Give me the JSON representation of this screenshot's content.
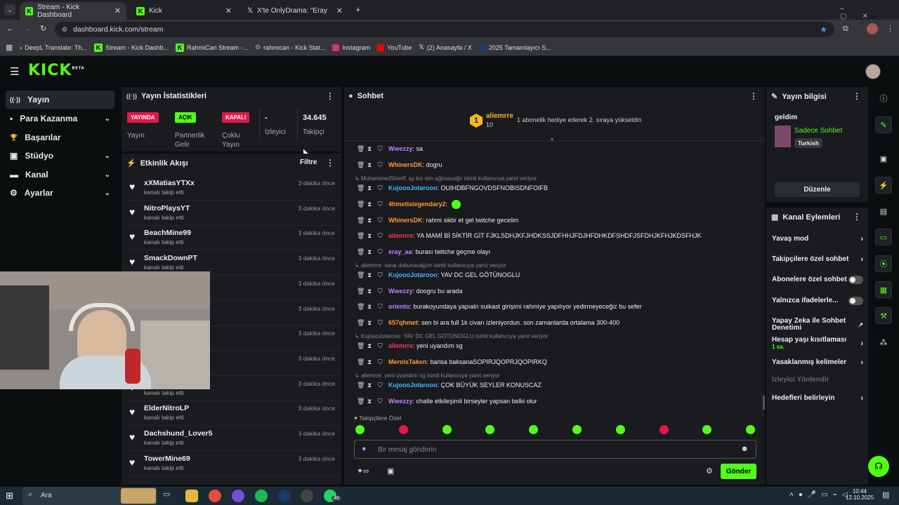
{
  "browser": {
    "tabs": [
      {
        "title": "Stream - Kick Dashboard",
        "close": "✕"
      },
      {
        "title": "Kick",
        "close": "✕"
      },
      {
        "title": "X'te OnlyDrama: \"Eray ve Dizci",
        "close": "✕"
      }
    ],
    "new_tab": "+",
    "url": "dashboard.kick.com/stream",
    "bookmarks": [
      "DeepL Translate: Th...",
      "Stream - Kick Dashb...",
      "RahmiCan Stream -...",
      "rahmican - Kick Stat...",
      "Instagram",
      "YouTube",
      "(2) Anasayfa / X",
      "2025 Tamamlayıcı S..."
    ]
  },
  "app": {
    "logo": "KICK",
    "logo_sup": "BETA"
  },
  "nav": {
    "items": [
      {
        "label": "Yayın",
        "icon": "((·))"
      },
      {
        "label": "Para Kazanma",
        "icon": "▪"
      },
      {
        "label": "Başarılar",
        "icon": "🏆"
      },
      {
        "label": "Stüdyo",
        "icon": "▣"
      },
      {
        "label": "Kanal",
        "icon": "▬"
      },
      {
        "label": "Ayarlar",
        "icon": "⚙"
      }
    ],
    "chev": "⌄"
  },
  "stats": {
    "title": "Yayın İstatistikleri",
    "badges": [
      "YAYINDA",
      "AÇIK",
      "KAPALI"
    ],
    "labels": [
      "Yayın",
      "Partnerlik Gelir",
      "Çoklu Yayın",
      "İzleyici",
      "Takipçi"
    ],
    "viewer_value": "-",
    "follower_value": "34.645"
  },
  "events": {
    "title": "Etkinlik Akışı",
    "filter": "Filtre",
    "sub": "kanalı takip etti",
    "time": "3 dakika önce",
    "items": [
      "xXMatiasYTXx",
      "NitroPlaysYT",
      "BeachMine99",
      "SmackDownPT",
      "",
      "",
      "",
      "",
      "",
      "ElderNitroLP",
      "Dachshund_Lover5",
      "TowerMine69"
    ]
  },
  "chat": {
    "title": "Sohbet",
    "top_user": "aliemrre",
    "top_rank": "1",
    "top_count": "10",
    "top_note": "1 abonelik hediye ederek 2. sıraya yükseldin",
    "messages": [
      {
        "reply": "",
        "user": "Wwezzy",
        "color": "#c77dff",
        "text": ": sa"
      },
      {
        "reply": "",
        "user": "WhinersDK",
        "color": "#ff9933",
        "text": ": dogru"
      },
      {
        "reply": "MuhammedSherif: ay kız sim ağlıosuuğn isimli kullanıcıya yanıt veriyor",
        "user": "KujoooJotarooo",
        "color": "#3db8ff",
        "text": ": OUIHDBFNGOVDSFNOBISDNFOIFB"
      },
      {
        "reply": "",
        "user": "4hmetislegendary2",
        "color": "#ff9933",
        "text": ":"
      },
      {
        "reply": "",
        "user": "WhinersDK",
        "color": "#ff9933",
        "text": ": rahmi siktir et gel twitche gecelim"
      },
      {
        "reply": "",
        "user": "aliemrre",
        "color": "#ff3355",
        "text": ": YA MAMİ Bİ SİKTİR GİT FJKLSDHJKFJHDKSSJDFHHJFDJHFDHKDFSHDFJSFDHJKFHJKDSFHJK"
      },
      {
        "reply": "",
        "user": "eray_aa",
        "color": "#c77dff",
        "text": ": burası twitche geçme olayı"
      },
      {
        "reply": "aliemrre: sana dokunacağım isimli kullanıcıya yanıt veriyor",
        "user": "KujoooJotarooo",
        "color": "#3db8ff",
        "text": ": YAV DC GEL GÖTÜNOGLU"
      },
      {
        "reply": "",
        "user": "Wwezzy",
        "color": "#c77dff",
        "text": ": doogru bu arada"
      },
      {
        "reply": "",
        "user": "oriento",
        "color": "#c77dff",
        "text": ": burakoyundaya yapıaln suikast girişimi rahmiye yapılıyor yedirmeyeceğiz bu sefer"
      },
      {
        "reply": "",
        "user": "657qhmet",
        "color": "#ff9933",
        "text": ": sen bi ara full 1k civarı izleniyordun. son zamanlarda ortalama 300-400"
      },
      {
        "reply": "KujoooJotarooo: YAV DC GEL GÖTÜNOGLU isimli kullanıcıya yanıt veriyor",
        "user": "aliemrre",
        "color": "#ff3355",
        "text": ": yeni uyandım sg"
      },
      {
        "reply": "",
        "user": "MerolsTaken",
        "color": "#ff9933",
        "text": ": barisa baksanaSOPIRJQOPRJQOPIRKQ"
      },
      {
        "reply": "aliemrre: yeni uyandım sg isimli kullanıcıya yanıt veriyor",
        "user": "KujoooJotarooo",
        "color": "#3db8ff",
        "text": ": ÇOK BÜYÜK SEYLER KONUSCAZ"
      },
      {
        "reply": "",
        "user": "Wwezzy",
        "color": "#c77dff",
        "text": ": chatle etkileşimli birseyler yapsan belki olur"
      }
    ],
    "follower_only": "Takipçilere Özel",
    "placeholder": "Bir mesaj gönderin",
    "send": "Gönder"
  },
  "info": {
    "title": "Yayın bilgisi",
    "stream_title": "geldim",
    "category": "Sadece Sohbet",
    "language": "Turkish",
    "edit": "Düzenle"
  },
  "actions": {
    "title": "Kanal Eylemleri",
    "rows": [
      {
        "label": "Yavaş mod",
        "kind": "arrow"
      },
      {
        "label": "Takipçilere özel sohbet",
        "kind": "arrow"
      },
      {
        "label": "Abonelere özel sohbet",
        "kind": "toggle"
      },
      {
        "label": "Yalnızca ifadelerle...",
        "kind": "toggle"
      },
      {
        "label": "Yapay Zeka ile Sohbet Denetimi",
        "kind": "ext"
      },
      {
        "label": "Hesap yaşı kısıtlaması",
        "kind": "arrow",
        "sub": "1 sa."
      },
      {
        "label": "Yasaklanmış kelimeler",
        "kind": "arrow"
      },
      {
        "label": "İzleyici Yönlendir",
        "kind": "disabled"
      },
      {
        "label": "Hedefleri belirleyin",
        "kind": "arrow"
      }
    ]
  },
  "taskbar": {
    "search": "Ara",
    "time": "10:44",
    "date": "12.10.2025",
    "badge": "46"
  },
  "colors": {
    "accent": "#53fc18",
    "live": "#e5174a",
    "panel": "#191b1f"
  }
}
